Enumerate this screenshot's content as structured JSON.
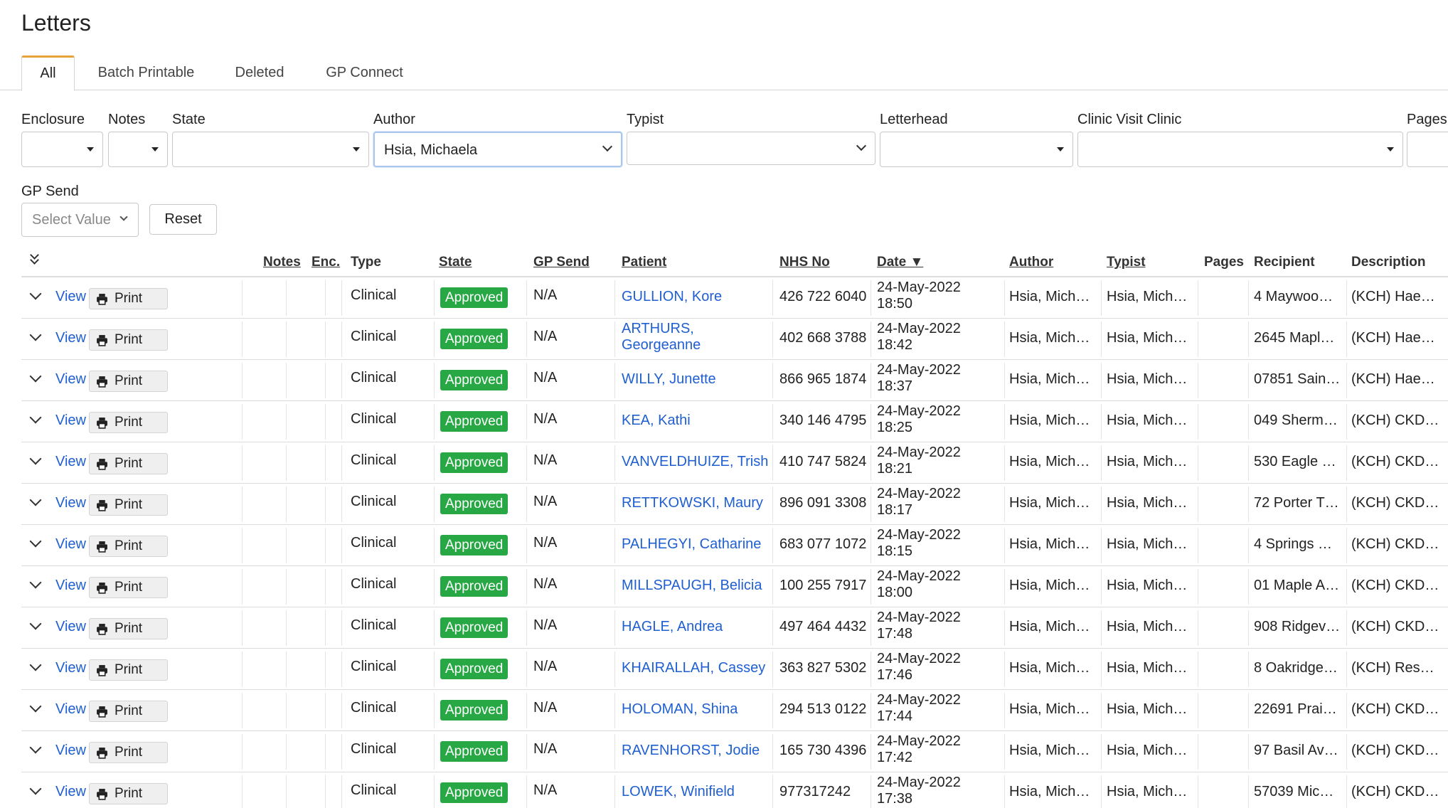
{
  "title": "Letters",
  "tabs": [
    {
      "label": "All",
      "active": true
    },
    {
      "label": "Batch Printable",
      "active": false
    },
    {
      "label": "Deleted",
      "active": false
    },
    {
      "label": "GP Connect",
      "active": false
    }
  ],
  "filters": {
    "enclosure": {
      "label": "Enclosure",
      "value": ""
    },
    "notes": {
      "label": "Notes",
      "value": ""
    },
    "state": {
      "label": "State",
      "value": ""
    },
    "author": {
      "label": "Author",
      "value": "Hsia, Michaela"
    },
    "typist": {
      "label": "Typist",
      "value": ""
    },
    "letterhead": {
      "label": "Letterhead",
      "value": ""
    },
    "clinic_visit_clinic": {
      "label": "Clinic Visit Clinic",
      "value": ""
    },
    "pages": {
      "label": "Pages",
      "value": ""
    },
    "gp_send": {
      "label": "GP Send",
      "placeholder": "Select Value"
    },
    "reset_label": "Reset"
  },
  "table": {
    "headers": {
      "notes": "Notes",
      "enc": "Enc.",
      "type": "Type",
      "state": "State",
      "gp_send": "GP Send",
      "patient": "Patient",
      "nhs_no": "NHS No",
      "date": "Date ▼",
      "author": "Author",
      "typist": "Typist",
      "pages": "Pages",
      "recipient": "Recipient",
      "description": "Description"
    },
    "action_view": "View",
    "action_print": "Print",
    "rows": [
      {
        "type": "Clinical",
        "state": "Approved",
        "gp_send": "N/A",
        "patient": "GULLION, Kore",
        "patient2": "",
        "nhs_no": "426 722 6040",
        "date": "24-May-2022",
        "time": "18:50",
        "author": "Hsia, Mich…",
        "typist": "Hsia, Mich…",
        "pages": "",
        "recipient": "4 Maywoo…",
        "description": "(KCH) Hae…"
      },
      {
        "type": "Clinical",
        "state": "Approved",
        "gp_send": "N/A",
        "patient": "ARTHURS,",
        "patient2": "Georgeanne",
        "nhs_no": "402 668 3788",
        "date": "24-May-2022",
        "time": "18:42",
        "author": "Hsia, Mich…",
        "typist": "Hsia, Mich…",
        "pages": "",
        "recipient": "2645 Mapl…",
        "description": "(KCH) Hae…"
      },
      {
        "type": "Clinical",
        "state": "Approved",
        "gp_send": "N/A",
        "patient": "WILLY, Junette",
        "patient2": "",
        "nhs_no": "866 965 1874",
        "date": "24-May-2022",
        "time": "18:37",
        "author": "Hsia, Mich…",
        "typist": "Hsia, Mich…",
        "pages": "",
        "recipient": "07851 Sain…",
        "description": "(KCH) Hae…"
      },
      {
        "type": "Clinical",
        "state": "Approved",
        "gp_send": "N/A",
        "patient": "KEA, Kathi",
        "patient2": "",
        "nhs_no": "340 146 4795",
        "date": "24-May-2022",
        "time": "18:25",
        "author": "Hsia, Mich…",
        "typist": "Hsia, Mich…",
        "pages": "",
        "recipient": "049 Sherm…",
        "description": "(KCH) CKD…"
      },
      {
        "type": "Clinical",
        "state": "Approved",
        "gp_send": "N/A",
        "patient": "VANVELDHUIZE, Trish",
        "patient2": "",
        "nhs_no": "410 747 5824",
        "date": "24-May-2022",
        "time": "18:21",
        "author": "Hsia, Mich…",
        "typist": "Hsia, Mich…",
        "pages": "",
        "recipient": "530 Eagle …",
        "description": "(KCH) CKD…"
      },
      {
        "type": "Clinical",
        "state": "Approved",
        "gp_send": "N/A",
        "patient": "RETTKOWSKI, Maury",
        "patient2": "",
        "nhs_no": "896 091 3308",
        "date": "24-May-2022",
        "time": "18:17",
        "author": "Hsia, Mich…",
        "typist": "Hsia, Mich…",
        "pages": "",
        "recipient": "72 Porter T…",
        "description": "(KCH) CKD…"
      },
      {
        "type": "Clinical",
        "state": "Approved",
        "gp_send": "N/A",
        "patient": "PALHEGYI, Catharine",
        "patient2": "",
        "nhs_no": "683 077 1072",
        "date": "24-May-2022",
        "time": "18:15",
        "author": "Hsia, Mich…",
        "typist": "Hsia, Mich…",
        "pages": "",
        "recipient": "4 Springs …",
        "description": "(KCH) CKD…"
      },
      {
        "type": "Clinical",
        "state": "Approved",
        "gp_send": "N/A",
        "patient": "MILLSPAUGH, Belicia",
        "patient2": "",
        "nhs_no": "100 255 7917",
        "date": "24-May-2022",
        "time": "18:00",
        "author": "Hsia, Mich…",
        "typist": "Hsia, Mich…",
        "pages": "",
        "recipient": "01 Maple A…",
        "description": "(KCH) CKD…"
      },
      {
        "type": "Clinical",
        "state": "Approved",
        "gp_send": "N/A",
        "patient": "HAGLE, Andrea",
        "patient2": "",
        "nhs_no": "497 464 4432",
        "date": "24-May-2022",
        "time": "17:48",
        "author": "Hsia, Mich…",
        "typist": "Hsia, Mich…",
        "pages": "",
        "recipient": "908 Ridgev…",
        "description": "(KCH) CKD…"
      },
      {
        "type": "Clinical",
        "state": "Approved",
        "gp_send": "N/A",
        "patient": "KHAIRALLAH, Cassey",
        "patient2": "",
        "nhs_no": "363 827 5302",
        "date": "24-May-2022",
        "time": "17:46",
        "author": "Hsia, Mich…",
        "typist": "Hsia, Mich…",
        "pages": "",
        "recipient": "8 Oakridge…",
        "description": "(KCH) Res…"
      },
      {
        "type": "Clinical",
        "state": "Approved",
        "gp_send": "N/A",
        "patient": "HOLOMAN, Shina",
        "patient2": "",
        "nhs_no": "294 513 0122",
        "date": "24-May-2022",
        "time": "17:44",
        "author": "Hsia, Mich…",
        "typist": "Hsia, Mich…",
        "pages": "",
        "recipient": "22691 Prai…",
        "description": "(KCH) CKD…"
      },
      {
        "type": "Clinical",
        "state": "Approved",
        "gp_send": "N/A",
        "patient": "RAVENHORST, Jodie",
        "patient2": "",
        "nhs_no": "165 730 4396",
        "date": "24-May-2022",
        "time": "17:42",
        "author": "Hsia, Mich…",
        "typist": "Hsia, Mich…",
        "pages": "",
        "recipient": "97 Basil Av…",
        "description": "(KCH) CKD…"
      },
      {
        "type": "Clinical",
        "state": "Approved",
        "gp_send": "N/A",
        "patient": "LOWEK, Winifield",
        "patient2": "",
        "nhs_no": "977317242",
        "date": "24-May-2022",
        "time": "17:38",
        "author": "Hsia, Mich…",
        "typist": "Hsia, Mich…",
        "pages": "",
        "recipient": "57039 Mic…",
        "description": "(KCH) CKD…"
      }
    ]
  }
}
